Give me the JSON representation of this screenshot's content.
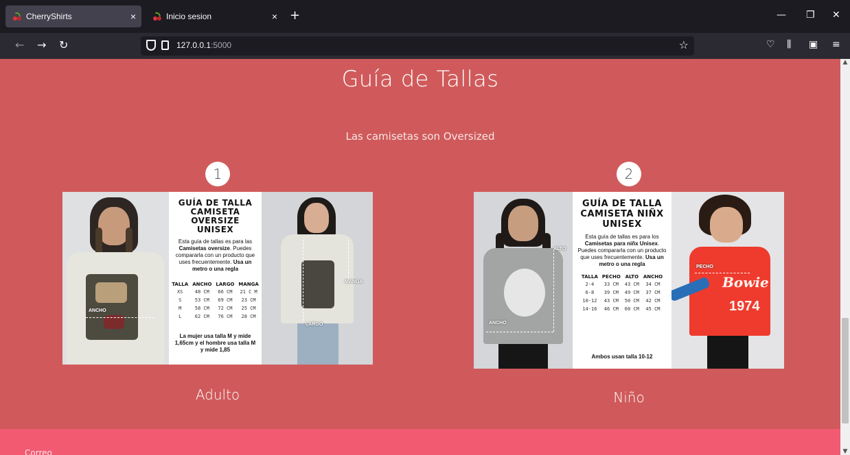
{
  "browser": {
    "tabs": [
      {
        "label": "CherryShirts",
        "active": true
      },
      {
        "label": "Inicio sesion",
        "active": false
      }
    ],
    "close_glyph": "×",
    "new_tab_glyph": "+",
    "url_host": "127.0.0.1",
    "url_port": ":5000",
    "icons": [
      "back-arrow-icon",
      "forward-arrow-icon",
      "reload-icon",
      "shield-icon",
      "page-icon",
      "star-icon",
      "pocket-icon",
      "library-icon",
      "reader-icon",
      "menu-icon"
    ]
  },
  "page": {
    "title": "Guía de Tallas",
    "subtitle": "Las camisetas son Oversized",
    "footer_label": "Correo",
    "colors": {
      "background": "#d05a5b",
      "footer": "#f25a72"
    }
  },
  "guides": [
    {
      "number": "1",
      "caption": "Adulto",
      "heading_lines": [
        "GUÍA DE TALLA",
        "CAMISETA OVERSIZE",
        "UNISEX"
      ],
      "desc_start": "Esta guía de tallas es para las ",
      "desc_bold1": "Camisetas oversize",
      "desc_mid": ". Puedes compararla con un producto que uses frecuentemente. ",
      "desc_bold2": "Usa un metro o una regla",
      "headers": [
        "TALLA",
        "ANCHO",
        "LARGO",
        "MANGA"
      ],
      "rows": [
        [
          "XS",
          "48 CM",
          "66 CM",
          "21 C M"
        ],
        [
          "S",
          "53 CM",
          "69 CM",
          "23 CM"
        ],
        [
          "M",
          "58 CM",
          "72 CM",
          "25 CM"
        ],
        [
          "L",
          "62 CM",
          "76 CM",
          "28 CM"
        ]
      ],
      "note": "La mujer usa talla M y mide 1,65cm y el hombre usa talla M y mide 1,85",
      "labels": {
        "ancho": "ANCHO",
        "manga": "MANGA",
        "largo": "LARGO"
      }
    },
    {
      "number": "2",
      "caption": "Niño",
      "heading_lines": [
        "GUÍA DE TALLA",
        "CAMISETA NIÑX",
        "UNISEX"
      ],
      "desc_start": "Esta guía de tallas es para los ",
      "desc_bold1": "Camisetas para niñx Unisex",
      "desc_mid": ". Puedes compararla con un producto que uses frecuentemente. ",
      "desc_bold2": "Usa un metro o una regla",
      "headers": [
        "TALLA",
        "PECHO",
        "ALTO",
        "ANCHO"
      ],
      "rows": [
        [
          "2-4",
          "33 CM",
          "43 CM",
          "34 CM"
        ],
        [
          "6-8",
          "39 CM",
          "49 CM",
          "37 CM"
        ],
        [
          "10-12",
          "43 CM",
          "50 CM",
          "42 CM"
        ],
        [
          "14-16",
          "46 CM",
          "60 CM",
          "45 CM"
        ]
      ],
      "note": "Ambos usan talla 10-12",
      "labels": {
        "alto": "ALTO",
        "ancho": "ANCHO",
        "pecho": "PECHO",
        "print": "Bowie",
        "print_year": "1974"
      }
    }
  ]
}
